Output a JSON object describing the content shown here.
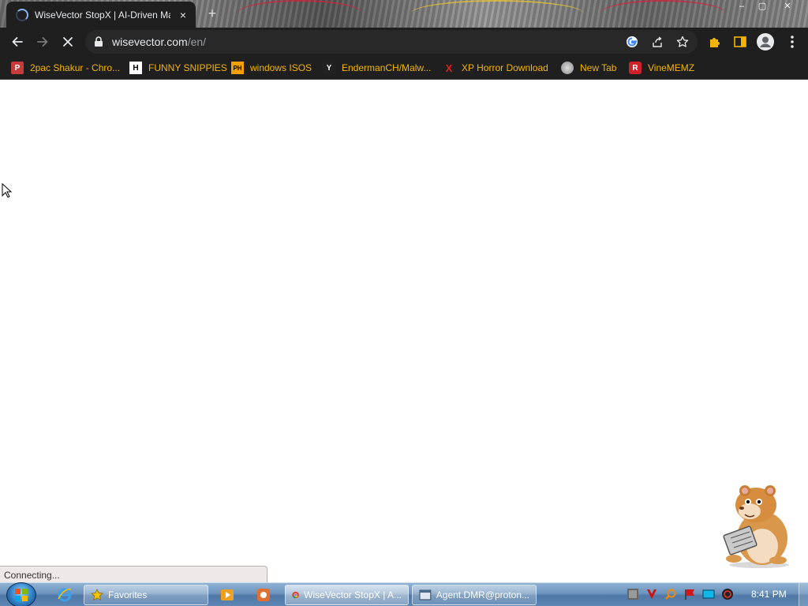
{
  "browser": {
    "tab": {
      "title": "WiseVector StopX | AI-Driven Ma",
      "close_icon": "×"
    },
    "new_tab_icon": "+",
    "window_controls": {
      "minimize": "–",
      "maximize": "▢",
      "close": "✕"
    },
    "address": {
      "host": "wisevector.com",
      "path": "/en/"
    },
    "toolbar_icons": [
      "back-icon",
      "forward-icon",
      "stop-reload-icon",
      "lock-icon",
      "google-icon",
      "share-icon",
      "star-icon",
      "extensions-icon",
      "side-panel-icon",
      "profile-icon",
      "menu-icon"
    ]
  },
  "bookmarks": [
    {
      "label": "2pac Shakur - Chro...",
      "icon": "P"
    },
    {
      "label": "FUNNY SNIPPIES",
      "icon": "H"
    },
    {
      "label": "windows ISOS",
      "icon": "PH"
    },
    {
      "label": "EndermanCH/Malw...",
      "icon": "Y"
    },
    {
      "label": "XP Horror Download",
      "icon": "X"
    },
    {
      "label": "New Tab",
      "icon": ""
    },
    {
      "label": "VineMEMZ",
      "icon": "R"
    }
  ],
  "status_bar": {
    "text": "Connecting..."
  },
  "taskbar": {
    "buttons": [
      {
        "label": "Favorites"
      },
      {
        "label": "WiseVector StopX | A..."
      },
      {
        "label": "Agent.DMR@proton..."
      }
    ],
    "clock": "8:41 PM"
  },
  "colors": {
    "chrome_dark": "#1f1f1f",
    "bookmark_text": "#f5b400",
    "taskbar_blue": "#5d86b3"
  }
}
